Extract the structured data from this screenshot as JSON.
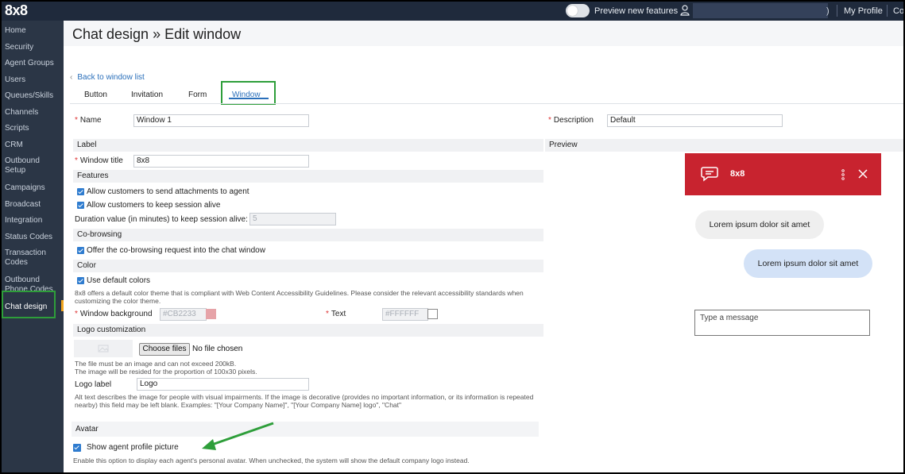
{
  "topbar": {
    "logo": "8x8",
    "preview_toggle_label": "Preview new features",
    "user_paren": ")",
    "my_profile": "My Profile",
    "cut_item": "Co"
  },
  "sidebar": {
    "items": [
      {
        "label": "Home"
      },
      {
        "label": "Security"
      },
      {
        "label": "Agent Groups"
      },
      {
        "label": "Users"
      },
      {
        "label": "Queues/Skills"
      },
      {
        "label": "Channels"
      },
      {
        "label": "Scripts"
      },
      {
        "label": "CRM"
      },
      {
        "label": "Outbound Setup"
      },
      {
        "label": "Campaigns"
      },
      {
        "label": "Broadcast"
      },
      {
        "label": "Integration"
      },
      {
        "label": "Status Codes"
      },
      {
        "label": "Transaction Codes"
      },
      {
        "label": "Outbound Phone Codes"
      },
      {
        "label": "Chat design"
      }
    ],
    "active": "Chat design"
  },
  "page": {
    "title": "Chat design » Edit window",
    "back_link": "Back to window list",
    "tabs": [
      "Button",
      "Invitation",
      "Form",
      "Window"
    ],
    "active_tab": "Window"
  },
  "form": {
    "name_label": "Name",
    "name_value": "Window 1",
    "description_label": "Description",
    "description_value": "Default",
    "label_section": "Label",
    "window_title_label": "Window title",
    "window_title_value": "8x8",
    "features_section": "Features",
    "allow_attachments": "Allow customers to send attachments to agent",
    "keep_session": "Allow customers to keep session alive",
    "duration_label": "Duration value (in minutes) to keep session alive:",
    "duration_value": "5",
    "cobrowsing_section": "Co-browsing",
    "cobrowsing_offer": "Offer the co-browsing request into the chat window",
    "color_section": "Color",
    "use_default_colors": "Use default colors",
    "color_note": "8x8 offers a default color theme that is compliant with Web Content Accessibility Guidelines. Please consider the relevant accessibility standards when customizing the color theme.",
    "window_background_label": "Window background",
    "window_background_value": "#CB2233",
    "text_color_label": "Text",
    "text_color_value": "#FFFFFF",
    "logo_section": "Logo customization",
    "choose_files": "Choose files",
    "no_file": "No file chosen",
    "file_note_1": "The file must be an image and can not exceed 200kB.",
    "file_note_2": "The image will be resided for the proportion of 100x30 pixels.",
    "logo_label_label": "Logo label",
    "logo_label_value": "Logo",
    "alt_note": "Alt text describes the image for people with visual impairments. If the image is decorative (provides no important information, or its information is repeated nearby) this field may be left blank. Examples: \"[Your Company Name]\", \"[Your Company Name] logo\", \"Chat\"",
    "avatar_section": "Avatar",
    "show_avatar": "Show agent profile picture",
    "avatar_note": "Enable this option to display each agent's personal avatar. When unchecked, the system will show the default company logo instead."
  },
  "preview": {
    "section": "Preview",
    "chat_title": "8x8",
    "incoming": "Lorem ipsum dolor sit amet",
    "outgoing": "Lorem ipsum dolor sit amet",
    "input_placeholder": "Type a message"
  },
  "colors": {
    "header_bg": "#1f2a3c",
    "sidebar_bg": "#2b3646",
    "window_bg": "#cb2233",
    "swatch_pink": "#e6a3a8",
    "highlight_green": "#2e9e3a",
    "link_blue": "#2a6fba"
  },
  "icons": [
    "user-icon",
    "chevron-left-icon",
    "chat-bubble-icon",
    "more-vertical-icon",
    "close-icon",
    "image-placeholder-icon",
    "annotation-arrow"
  ]
}
